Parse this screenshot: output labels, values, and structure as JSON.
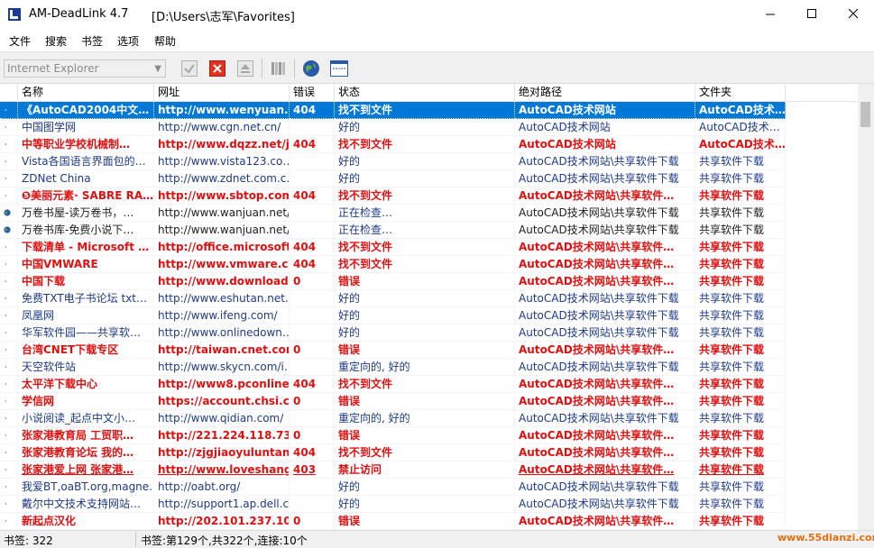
{
  "window": {
    "app_name": "AM-DeadLink 4.7",
    "path": "[D:\\Users\\志军\\Favorites]"
  },
  "menu": [
    "文件",
    "搜索",
    "书签",
    "选项",
    "帮助"
  ],
  "toolbar": {
    "browser": "Internet Explorer",
    "icons": [
      "check-icon",
      "delete-icon",
      "eject-icon",
      "columns-icon",
      "globe-icon",
      "window-icon"
    ]
  },
  "columns": [
    "名称",
    "网址",
    "错误",
    "状态",
    "绝对路径",
    "文件夹"
  ],
  "rows": [
    {
      "type": "err",
      "selected": true,
      "icon": "dot",
      "name": "《AutoCAD2004中文…",
      "url": "http://www.wenyuan.c…",
      "error": "404",
      "status": "找不到文件",
      "path": "AutoCAD技术网站",
      "folder": "AutoCAD技术…"
    },
    {
      "type": "ok",
      "icon": "dot",
      "name": "中国图学网",
      "url": "http://www.cgn.net.cn/",
      "error": "",
      "status": "好的",
      "path": "AutoCAD技术网站",
      "folder": "AutoCAD技术…"
    },
    {
      "type": "err",
      "icon": "dot",
      "name": "中等职业学校机械制…",
      "url": "http://www.dqzz.net/j…",
      "error": "404",
      "status": "找不到文件",
      "path": "AutoCAD技术网站",
      "folder": "AutoCAD技术…"
    },
    {
      "type": "ok",
      "icon": "dot",
      "name": "Vista各国语言界面包的…",
      "url": "http://www.vista123.co…",
      "error": "",
      "status": "好的",
      "path": "AutoCAD技术网站\\共享软件下载",
      "folder": "共享软件下载"
    },
    {
      "type": "ok",
      "icon": "dot",
      "name": "ZDNet China",
      "url": "http://www.zdnet.com.c…",
      "error": "",
      "status": "好的",
      "path": "AutoCAD技术网站\\共享软件下载",
      "folder": "共享软件下载"
    },
    {
      "type": "err",
      "icon": "dot",
      "name": "❺美丽元素· SABRE RA…",
      "url": "http://www.sbtop.com…",
      "error": "404",
      "status": "找不到文件",
      "path": "AutoCAD技术网站\\共享软件…",
      "folder": "共享软件下载"
    },
    {
      "type": "checking",
      "icon": "globe",
      "name": "万卷书屋-读万卷书，…",
      "url": "http://www.wanjuan.net/",
      "error": "",
      "status": "正在检查…",
      "path": "AutoCAD技术网站\\共享软件下载",
      "folder": "共享软件下载"
    },
    {
      "type": "checking",
      "icon": "globe",
      "name": "万卷书库-免费小说下…",
      "url": "http://www.wanjuan.net/",
      "error": "",
      "status": "正在检查…",
      "path": "AutoCAD技术网站\\共享软件下载",
      "folder": "共享软件下载"
    },
    {
      "type": "err",
      "icon": "dot",
      "name": "下载清单 - Microsoft …",
      "url": "http://office.microsoft.…",
      "error": "404",
      "status": "找不到文件",
      "path": "AutoCAD技术网站\\共享软件…",
      "folder": "共享软件下载"
    },
    {
      "type": "err",
      "icon": "dot",
      "name": "中国VMWARE",
      "url": "http://www.vmware.c…",
      "error": "404",
      "status": "找不到文件",
      "path": "AutoCAD技术网站\\共享软件…",
      "folder": "共享软件下载"
    },
    {
      "type": "err",
      "icon": "dot",
      "name": "中国下载",
      "url": "http://www.download.…",
      "error": "0",
      "status": "错误",
      "path": "AutoCAD技术网站\\共享软件…",
      "folder": "共享软件下载"
    },
    {
      "type": "ok",
      "icon": "dot",
      "name": "免费TXT电子书论坛 txt…",
      "url": "http://www.eshutan.net…",
      "error": "",
      "status": "好的",
      "path": "AutoCAD技术网站\\共享软件下载",
      "folder": "共享软件下载"
    },
    {
      "type": "ok",
      "icon": "dot",
      "name": "凤凰网",
      "url": "http://www.ifeng.com/",
      "error": "",
      "status": "好的",
      "path": "AutoCAD技术网站\\共享软件下载",
      "folder": "共享软件下载"
    },
    {
      "type": "ok",
      "icon": "dot",
      "name": "华军软件园——共享软…",
      "url": "http://www.onlinedown…",
      "error": "",
      "status": "好的",
      "path": "AutoCAD技术网站\\共享软件下载",
      "folder": "共享软件下载"
    },
    {
      "type": "err",
      "icon": "dot",
      "name": "台湾CNET下载专区",
      "url": "http://taiwan.cnet.com…",
      "error": "0",
      "status": "错误",
      "path": "AutoCAD技术网站\\共享软件…",
      "folder": "共享软件下载"
    },
    {
      "type": "ok",
      "icon": "dot",
      "name": "天空软件站",
      "url": "http://www.skycn.com/i…",
      "error": "",
      "status": "重定向的, 好的",
      "path": "AutoCAD技术网站\\共享软件下载",
      "folder": "共享软件下载"
    },
    {
      "type": "err",
      "icon": "dot",
      "name": "太平洋下载中心",
      "url": "http://www8.pconline.…",
      "error": "404",
      "status": "找不到文件",
      "path": "AutoCAD技术网站\\共享软件…",
      "folder": "共享软件下载"
    },
    {
      "type": "err",
      "icon": "dot",
      "name": "学信网",
      "url": "https://account.chsi.co…",
      "error": "0",
      "status": "错误",
      "path": "AutoCAD技术网站\\共享软件…",
      "folder": "共享软件下载"
    },
    {
      "type": "ok",
      "icon": "dot",
      "name": "小说阅读_起点中文小…",
      "url": "http://www.qidian.com/",
      "error": "",
      "status": "重定向的, 好的",
      "path": "AutoCAD技术网站\\共享软件下载",
      "folder": "共享软件下载"
    },
    {
      "type": "err",
      "icon": "dot",
      "name": "张家港教育局 工贸职…",
      "url": "http://221.224.118.73/…",
      "error": "0",
      "status": "错误",
      "path": "AutoCAD技术网站\\共享软件…",
      "folder": "共享软件下载"
    },
    {
      "type": "err",
      "icon": "dot",
      "name": "张家港教育论坛 我的…",
      "url": "http://zjgjiaoyuluntan.5…",
      "error": "404",
      "status": "找不到文件",
      "path": "AutoCAD技术网站\\共享软件…",
      "folder": "共享软件下载"
    },
    {
      "type": "err",
      "underline": true,
      "icon": "dot",
      "name": "张家港爱上网 张家港…",
      "url": "http://www.loveshang.…",
      "error": "403",
      "status": "禁止访问",
      "path": "AutoCAD技术网站\\共享软件…",
      "folder": "共享软件下载"
    },
    {
      "type": "ok",
      "icon": "dot",
      "name": "我爱BT,oaBT.org,magne…",
      "url": "http://oabt.org/",
      "error": "",
      "status": "好的",
      "path": "AutoCAD技术网站\\共享软件下载",
      "folder": "共享软件下载"
    },
    {
      "type": "ok",
      "icon": "dot",
      "name": "戴尔中文技术支持网站…",
      "url": "http://support1.ap.dell.c…",
      "error": "",
      "status": "好的",
      "path": "AutoCAD技术网站\\共享软件下载",
      "folder": "共享软件下载"
    },
    {
      "type": "err",
      "icon": "dot",
      "name": "新起点汉化",
      "url": "http://202.101.237.103…",
      "error": "0",
      "status": "错误",
      "path": "AutoCAD技术网站\\共享软件…",
      "folder": "共享软件下载"
    }
  ],
  "statusbar": {
    "left": "书签: 322",
    "right": "书签:第129个,共322个,连接:10个"
  },
  "watermark": "www.55dianzi.com",
  "colors": {
    "error": "#e01010",
    "ok": "#1d3a8c",
    "selected": "#0078d7"
  }
}
